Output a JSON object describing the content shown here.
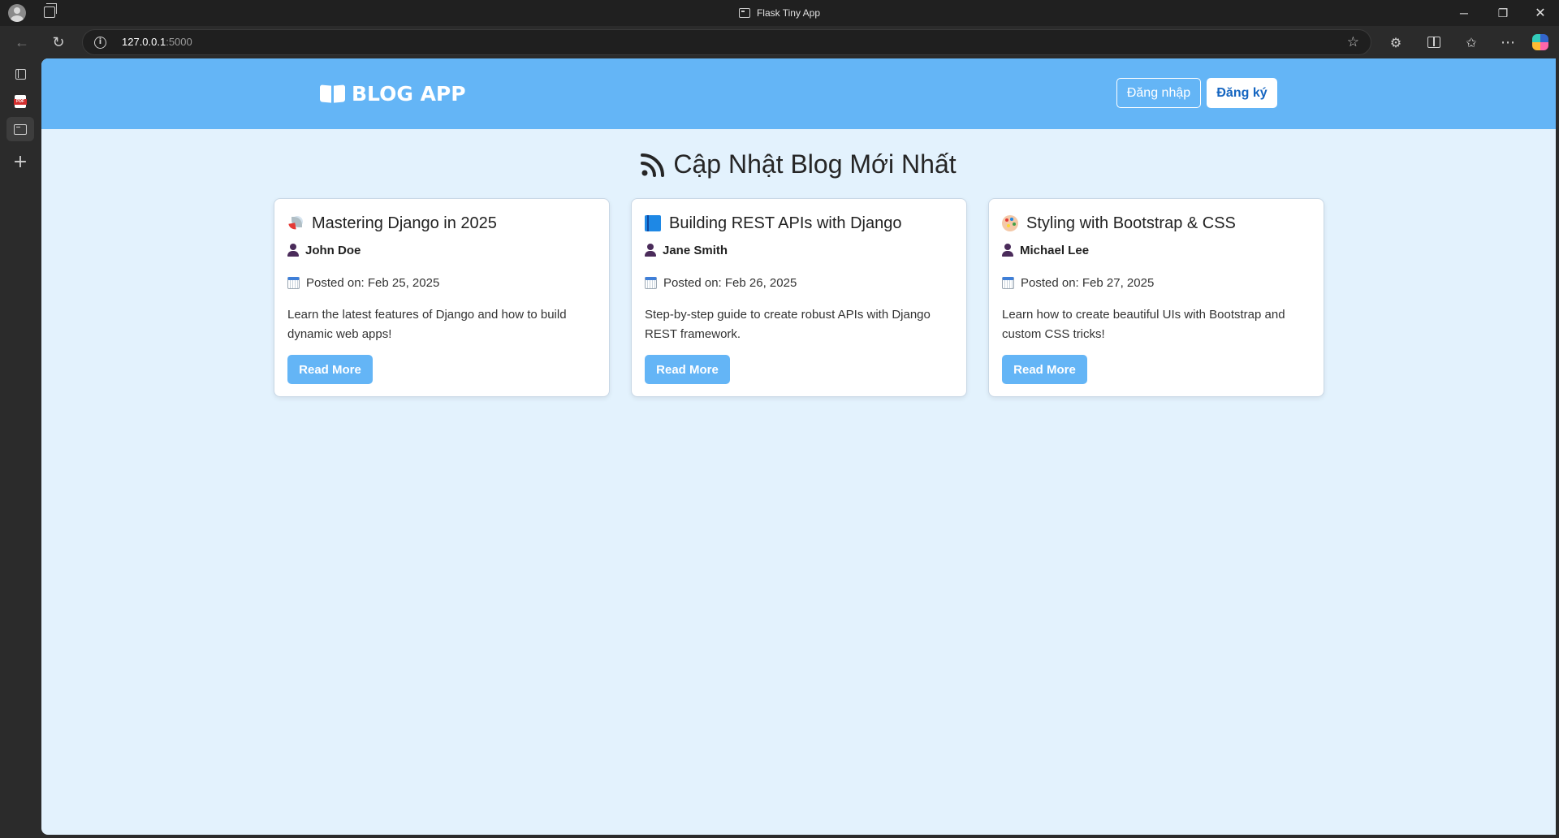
{
  "window": {
    "title": "Flask Tiny App"
  },
  "browser": {
    "url_host": "127.0.0.1",
    "url_port": ":5000"
  },
  "header": {
    "brand": "BLOG APP",
    "login_label": "Đăng nhập",
    "register_label": "Đăng ký"
  },
  "main": {
    "title": "Cập Nhật Blog Mới Nhất",
    "posts": [
      {
        "title": "Mastering Django in 2025",
        "emoji": "rocket-icon",
        "author": "John Doe",
        "date": "Posted on: Feb 25, 2025",
        "description": "Learn the latest features of Django and how to build dynamic web apps!",
        "button": "Read More"
      },
      {
        "title": "Building REST APIs with Django",
        "emoji": "blue-book-icon",
        "author": "Jane Smith",
        "date": "Posted on: Feb 26, 2025",
        "description": "Step-by-step guide to create robust APIs with Django REST framework.",
        "button": "Read More"
      },
      {
        "title": "Styling with Bootstrap & CSS",
        "emoji": "palette-icon",
        "author": "Michael Lee",
        "date": "Posted on: Feb 27, 2025",
        "description": "Learn how to create beautiful UIs with Bootstrap and custom CSS tricks!",
        "button": "Read More"
      }
    ]
  },
  "colors": {
    "header_bg": "#64b5f6",
    "page_bg": "#e3f2fd",
    "accent": "#64b5f6",
    "register_text": "#1565c0"
  }
}
